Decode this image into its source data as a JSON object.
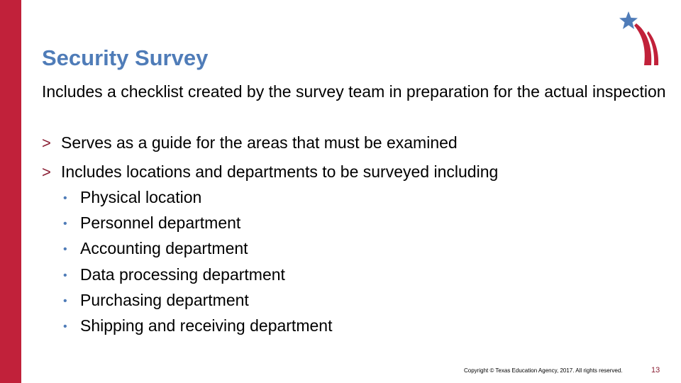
{
  "slide": {
    "title": "Security Survey",
    "intro": "Includes a checklist created by the survey team in preparation for the actual inspection",
    "bullets": [
      {
        "marker": ">",
        "text": "Serves as a guide for the areas that must be examined"
      },
      {
        "marker": ">",
        "text": "Includes locations and departments to be surveyed including",
        "subitems": [
          {
            "marker": "•",
            "text": "Physical location"
          },
          {
            "marker": "•",
            "text": "Personnel department"
          },
          {
            "marker": "•",
            "text": "Accounting department"
          },
          {
            "marker": "•",
            "text": "Data processing department"
          },
          {
            "marker": "•",
            "text": "Purchasing department"
          },
          {
            "marker": "•",
            "text": "Shipping and receiving department"
          }
        ]
      }
    ]
  },
  "footer": {
    "copyright": "Copyright © Texas Education Agency, 2017. All rights reserved.",
    "page_number": "13"
  },
  "logo": {
    "icon": "star-with-stripes-icon"
  },
  "colors": {
    "accent_red": "#C1213A",
    "title_blue": "#4F7CB8",
    "chevron_red": "#8B2035",
    "star_blue": "#4F7CB8"
  }
}
